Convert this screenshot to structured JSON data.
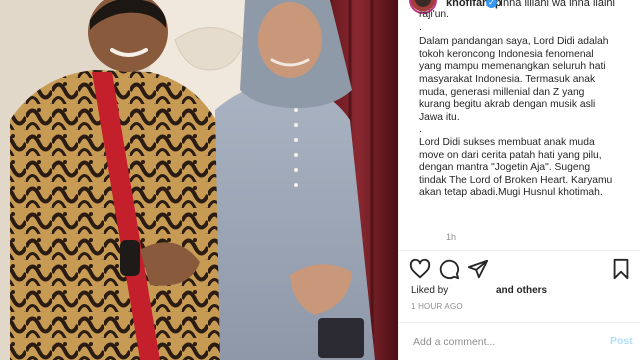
{
  "post": {
    "username": "khofifah.ip",
    "caption_top": "Inna lillahi wa inna ilaihi",
    "caption_lines": [
      "raji'un.",
      "."
    ],
    "paragraph_1": "Dalam pandangan saya, Lord Didi adalah tokoh keroncong Indonesia fenomenal yang mampu memenangkan seluruh hati masyarakat Indonesia. Termasuk anak muda, generasi millenial dan Z yang kurang begitu akrab dengan musik asli Jawa itu.",
    "separator_dot": ".",
    "paragraph_2": "Lord Didi sukses membuat anak muda move on dari cerita patah hati yang pilu, dengan mantra \"Jogetin Aja\". Sugeng tindak The Lord of Broken Heart. Karyamu akan tetap abadi.Mugi Husnul khotimah.",
    "comment_time": "1h"
  },
  "actions": {
    "like_icon": "heart-icon",
    "comment_icon": "comment-icon",
    "share_icon": "send-icon",
    "save_icon": "bookmark-icon"
  },
  "likes": {
    "prefix": "Liked by",
    "others": "and others"
  },
  "posted_ago": "1 HOUR AGO",
  "comment_box": {
    "placeholder": "Add a comment...",
    "post_label": "Post"
  },
  "colors": {
    "link_blue_disabled": "#b2dffc",
    "verified_blue": "#3897f0",
    "text": "#262626",
    "muted": "#8e8e8e"
  }
}
